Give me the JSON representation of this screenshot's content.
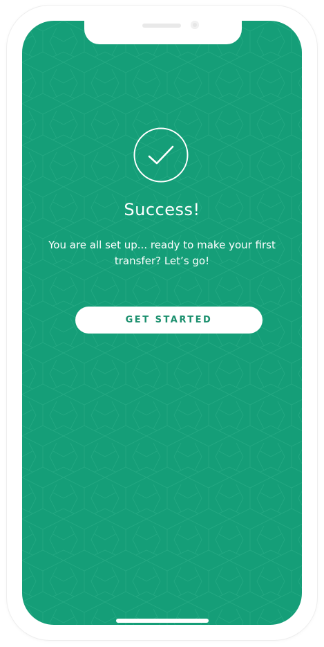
{
  "screen": {
    "background_color": "#159e78",
    "accent_color": "#1a8f6d"
  },
  "icons": {
    "success": "check-circle-icon"
  },
  "success": {
    "title": "Success!",
    "message": "You are all set up... ready to make your first transfer? Let’s go!"
  },
  "actions": {
    "get_started_label": "GET STARTED"
  }
}
